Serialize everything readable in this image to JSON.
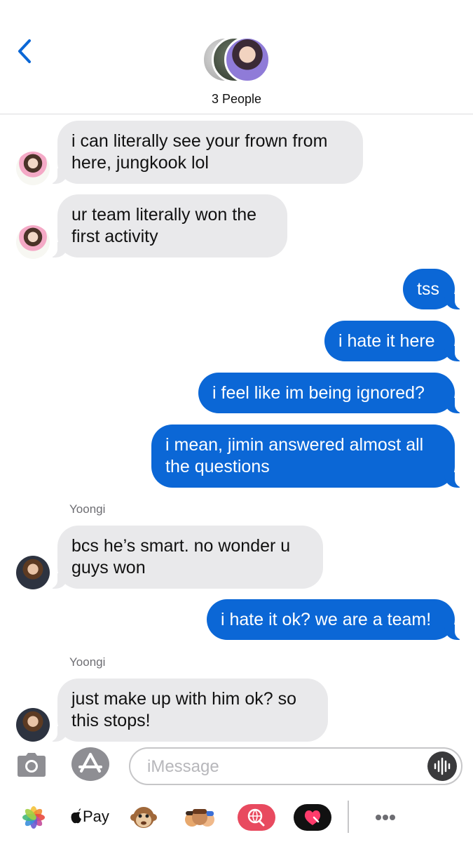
{
  "header": {
    "title": "3 People"
  },
  "messages": [
    {
      "side": "in",
      "sender_label": "",
      "text": "i can literally see your frown from here, jungkook lol"
    },
    {
      "side": "in",
      "sender_label": "",
      "text": "ur team literally won the first activity"
    },
    {
      "side": "out",
      "text": "tss"
    },
    {
      "side": "out",
      "text": "i hate it here"
    },
    {
      "side": "out",
      "text": "i feel like im being ignored?"
    },
    {
      "side": "out",
      "text": "i mean, jimin answered almost all the questions"
    },
    {
      "side": "in",
      "sender_label": "Yoongi",
      "text": "bcs he’s smart. no wonder u guys won"
    },
    {
      "side": "out",
      "text": "i hate it ok? we are a team!"
    },
    {
      "side": "in",
      "sender_label": "Yoongi",
      "text": "just make up with him ok? so this stops!"
    }
  ],
  "composer": {
    "placeholder": "iMessage"
  },
  "drawer": {
    "apple_pay_label": "Pay"
  },
  "colors": {
    "outgoing": "#0b67d6",
    "incoming": "#e9e9eb",
    "back_chevron": "#0b67d6"
  }
}
